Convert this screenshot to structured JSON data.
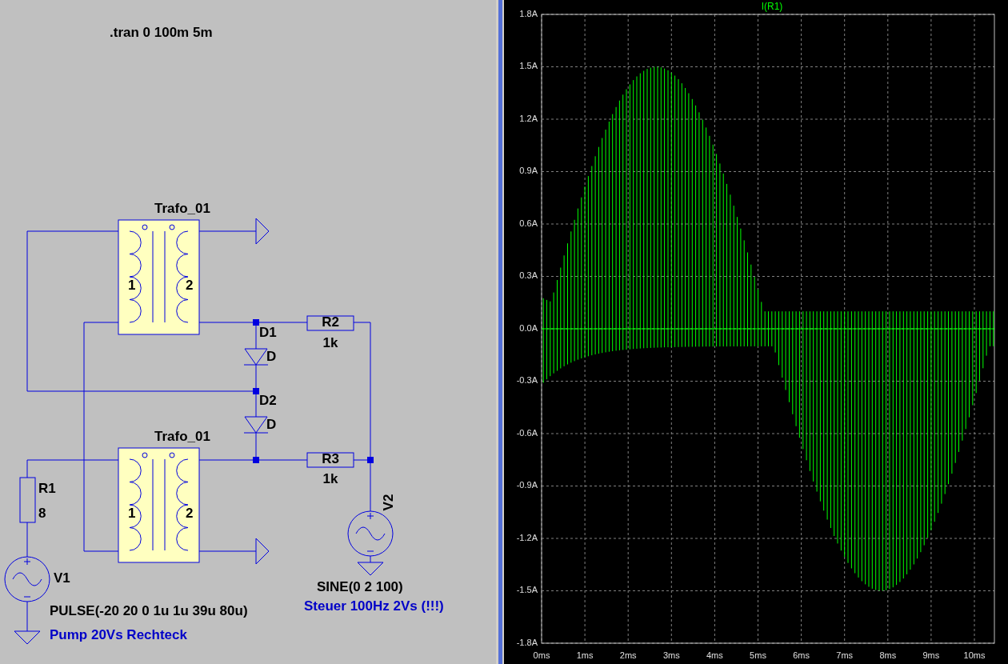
{
  "schematic": {
    "directive": ".tran 0 100m 5m",
    "components": [
      {
        "kind": "transformer",
        "name": "Trafo_01",
        "pin_labels": [
          "1",
          "2"
        ]
      },
      {
        "kind": "transformer",
        "name": "Trafo_01",
        "pin_labels": [
          "1",
          "2"
        ]
      },
      {
        "kind": "diode",
        "name": "D1",
        "value": "D"
      },
      {
        "kind": "diode",
        "name": "D2",
        "value": "D"
      },
      {
        "kind": "resistor",
        "name": "R2",
        "value": "1k"
      },
      {
        "kind": "resistor",
        "name": "R3",
        "value": "1k"
      },
      {
        "kind": "resistor",
        "name": "R1",
        "value": "8"
      },
      {
        "kind": "voltage_source",
        "name": "V1",
        "value": "PULSE(-20 20 0 1u 1u 39u 80u)",
        "comment": "Pump 20Vs Rechteck"
      },
      {
        "kind": "voltage_source",
        "name": "V2",
        "value": "SINE(0 2 100)",
        "comment": "Steuer 100Hz 2Vs (!!!)"
      }
    ]
  },
  "plot": {
    "trace": "I(R1)",
    "y_ticks": [
      "1.8A",
      "1.5A",
      "1.2A",
      "0.9A",
      "0.6A",
      "0.3A",
      "0.0A",
      "-0.3A",
      "-0.6A",
      "-0.9A",
      "-1.2A",
      "-1.5A",
      "-1.8A"
    ],
    "x_ticks": [
      "0ms",
      "1ms",
      "2ms",
      "3ms",
      "4ms",
      "5ms",
      "6ms",
      "7ms",
      "8ms",
      "9ms",
      "10ms"
    ]
  }
}
